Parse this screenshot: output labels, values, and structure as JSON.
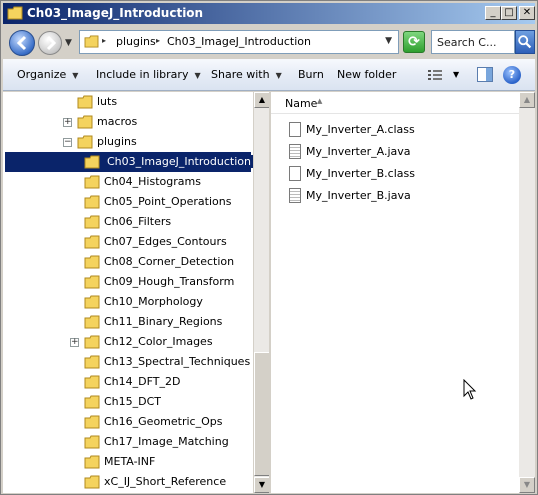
{
  "window": {
    "title": "Ch03_ImageJ_Introduction",
    "controls": {
      "minimize": "_",
      "maximize": "□",
      "close": "✕"
    }
  },
  "address": {
    "crumbs": [
      "plugins",
      "Ch03_ImageJ_Introduction"
    ],
    "search_placeholder": "Search C..."
  },
  "toolbar": {
    "organize": "Organize",
    "include_in_library": "Include in library",
    "share_with": "Share with",
    "burn": "Burn",
    "new_folder": "New folder",
    "help": "?"
  },
  "tree": {
    "items": [
      {
        "label": "luts",
        "expander": ""
      },
      {
        "label": "macros",
        "expander": "+"
      },
      {
        "label": "plugins",
        "expander": "−"
      },
      {
        "label": "Ch03_ImageJ_Introduction",
        "selected": true
      },
      {
        "label": "Ch04_Histograms"
      },
      {
        "label": "Ch05_Point_Operations"
      },
      {
        "label": "Ch06_Filters"
      },
      {
        "label": "Ch07_Edges_Contours"
      },
      {
        "label": "Ch08_Corner_Detection"
      },
      {
        "label": "Ch09_Hough_Transform"
      },
      {
        "label": "Ch10_Morphology"
      },
      {
        "label": "Ch11_Binary_Regions"
      },
      {
        "label": "Ch12_Color_Images",
        "expander": "+"
      },
      {
        "label": "Ch13_Spectral_Techniques"
      },
      {
        "label": "Ch14_DFT_2D"
      },
      {
        "label": "Ch15_DCT"
      },
      {
        "label": "Ch16_Geometric_Ops"
      },
      {
        "label": "Ch17_Image_Matching"
      },
      {
        "label": "META-INF"
      },
      {
        "label": "xC_IJ_Short_Reference"
      }
    ]
  },
  "filelist": {
    "column_name": "Name",
    "files": [
      {
        "name": "My_Inverter_A.class",
        "kind": "class"
      },
      {
        "name": "My_Inverter_A.java",
        "kind": "java"
      },
      {
        "name": "My_Inverter_B.class",
        "kind": "class"
      },
      {
        "name": "My_Inverter_B.java",
        "kind": "java"
      }
    ]
  },
  "colors": {
    "titlebar": "#0a246a",
    "selection": "#0a246a",
    "folder": "#f4d35e"
  }
}
